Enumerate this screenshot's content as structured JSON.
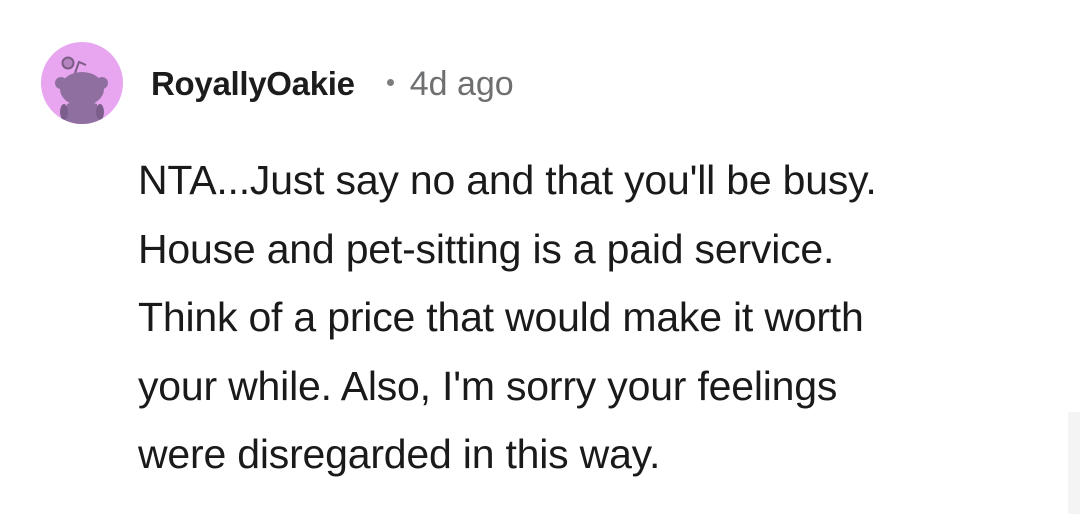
{
  "comment": {
    "avatar_icon": "reddit-snoo-avatar-icon",
    "avatar_color": "#e8a6f1",
    "username": "RoyallyOakie",
    "separator": "•",
    "timestamp": "4d ago",
    "body_lines": [
      "NTA...Just say no and that you'll be busy.",
      "House and pet-sitting is a paid service.",
      "Think of a price that would make it worth",
      "your while. Also, I'm sorry your feelings",
      "were disregarded in this way."
    ]
  }
}
